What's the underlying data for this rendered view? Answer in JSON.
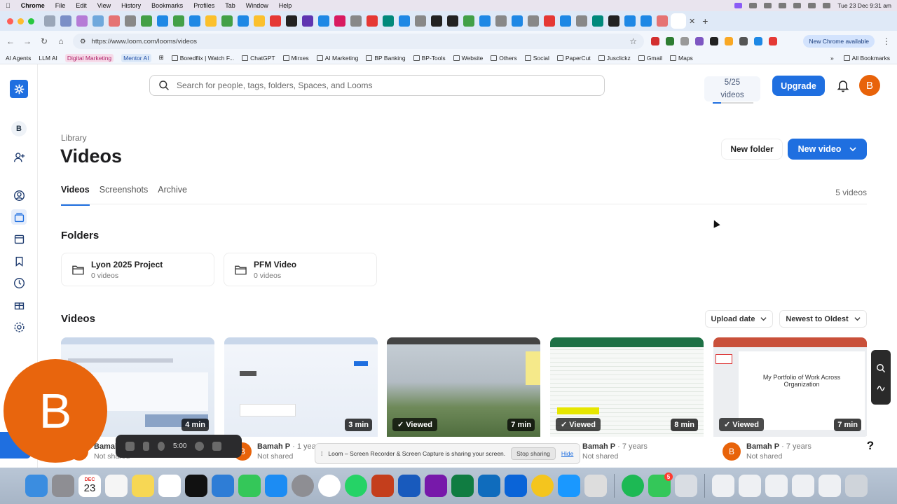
{
  "menubar": {
    "items": [
      "Chrome",
      "File",
      "Edit",
      "View",
      "History",
      "Bookmarks",
      "Profiles",
      "Tab",
      "Window",
      "Help"
    ],
    "datetime": "Tue 23 Dec  9:31 am"
  },
  "browser": {
    "url": "https://www.loom.com/looms/videos",
    "chrome_available": "New Chrome available",
    "bookmarks": [
      "AI Agents",
      "LLM AI",
      "Digital Marketing",
      "Mentor AI",
      "Boredflix | Watch F...",
      "ChatGPT",
      "Mirxes",
      "AI Marketing",
      "BP Banking",
      "BP-Tools",
      "Website",
      "Others",
      "Social",
      "PaperCut",
      "Jusclickz",
      "Gmail",
      "Maps"
    ],
    "all_bookmarks": "All Bookmarks",
    "more": "»"
  },
  "header": {
    "search_placeholder": "Search for people, tags, folders, Spaces, and Looms",
    "quota_count": "5/25",
    "quota_label": "videos",
    "quota_fraction": 0.2,
    "upgrade_label": "Upgrade",
    "avatar_initial": "B"
  },
  "sidebar": {
    "workspace_initial": "B",
    "icons": [
      "loom-logo-icon",
      "add-user-icon",
      "user-circle-icon",
      "library-icon",
      "calendar-icon",
      "bookmark-icon",
      "clock-icon",
      "gift-icon",
      "settings-icon"
    ]
  },
  "page": {
    "breadcrumb": "Library",
    "title": "Videos",
    "new_folder_label": "New folder",
    "new_video_label": "New video",
    "tabs": [
      {
        "label": "Videos",
        "active": true
      },
      {
        "label": "Screenshots",
        "active": false
      },
      {
        "label": "Archive",
        "active": false
      }
    ],
    "video_count": "5 videos"
  },
  "folders": {
    "heading": "Folders",
    "items": [
      {
        "name": "Lyon 2025 Project",
        "count": "0 videos"
      },
      {
        "name": "PFM Video",
        "count": "0 videos"
      }
    ]
  },
  "videos": {
    "heading": "Videos",
    "sort_field": "Upload date",
    "sort_order": "Newest to Oldest",
    "items": [
      {
        "duration": "4 min",
        "viewed": "",
        "owner": "Bamah P",
        "age": "",
        "shared": "Not shared"
      },
      {
        "duration": "3 min",
        "viewed": "",
        "owner": "Bamah P",
        "age": "· 1 year",
        "shared": "Not shared"
      },
      {
        "duration": "7 min",
        "viewed": "Viewed",
        "owner": "",
        "age": "",
        "shared": ""
      },
      {
        "duration": "8 min",
        "viewed": "Viewed",
        "owner": "Bamah P",
        "age": "· 7 years",
        "shared": "Not shared"
      },
      {
        "duration": "7 min",
        "viewed": "Viewed",
        "owner": "Bamah P",
        "age": "· 7 years",
        "shared": "Not shared",
        "thumb_title": "My Portfolio of Work Across Organization"
      }
    ]
  },
  "recording": {
    "camera_initial": "B",
    "timer": "5:00",
    "sharing_message": "Loom – Screen Recorder & Screen Capture is sharing your screen.",
    "stop_sharing": "Stop sharing",
    "hide": "Hide"
  },
  "help_label": "?",
  "dock": {
    "calendar_month": "DEC",
    "calendar_day": "23",
    "facetime_badge": "5"
  }
}
